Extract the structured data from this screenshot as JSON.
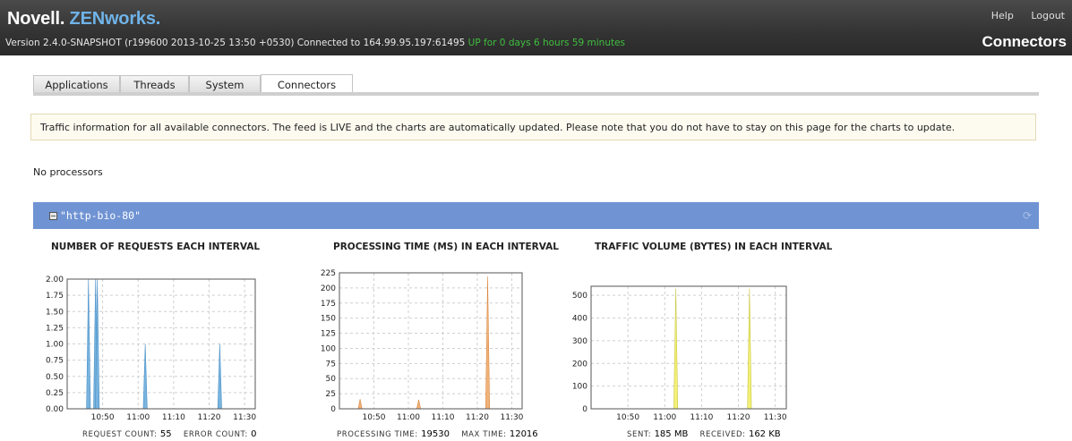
{
  "header": {
    "brand_main": "Novell.",
    "brand_product": "ZENworks.",
    "version_text": "Version 2.4.0-SNAPSHOT (r199600 2013-10-25 13:50 +0530) Connected to 164.99.95.197:61495",
    "uptime_text": "UP for 0 days 6 hours 59 minutes",
    "links": [
      "Help",
      "Logout"
    ],
    "page_name": "Connectors"
  },
  "tabs": [
    "Applications",
    "Threads",
    "System",
    "Connectors"
  ],
  "active_tab": "Connectors",
  "notice": "Traffic information for all available connectors. The feed is LIVE and the charts are automatically updated. Please note that you do not have to stay on this page for the charts to update.",
  "no_processors": "No processors",
  "connector": {
    "toggle": "−",
    "name": "\"http-bio-80\""
  },
  "colors": {
    "header_bg": "#333333",
    "brand_accent": "#6fb3e8",
    "uptime": "#3fbf3f",
    "connector_bar": "#6f93d3",
    "requests_series": "#79b4de",
    "processing_series": "#f0b27a",
    "traffic_series": "#f3f078"
  },
  "chart_data": [
    {
      "type": "area",
      "title": "NUMBER OF REQUESTS EACH INTERVAL",
      "x_ticks": [
        "10:50",
        "11:00",
        "11:10",
        "11:20",
        "11:30"
      ],
      "y_ticks": [
        "0.00",
        "0.25",
        "0.50",
        "0.75",
        "1.00",
        "1.25",
        "1.50",
        "1.75",
        "2.00"
      ],
      "ylim": [
        0,
        2
      ],
      "grid": true,
      "spikes": [
        {
          "t": "10:46",
          "value": 2.0
        },
        {
          "t": "10:48",
          "value": 2.0
        },
        {
          "t": "10:48.5",
          "value": 2.0
        },
        {
          "t": "11:02",
          "value": 1.0
        },
        {
          "t": "11:23",
          "value": 1.0
        }
      ],
      "footer": [
        {
          "label": "REQUEST COUNT:",
          "value": "55"
        },
        {
          "label": "ERROR COUNT:",
          "value": "0"
        }
      ]
    },
    {
      "type": "area",
      "title": "PROCESSING TIME (MS) IN EACH INTERVAL",
      "x_ticks": [
        "10:50",
        "11:00",
        "11:10",
        "11:20",
        "11:30"
      ],
      "y_ticks": [
        "0",
        "25",
        "50",
        "75",
        "100",
        "125",
        "150",
        "175",
        "200",
        "225"
      ],
      "ylim": [
        0,
        225
      ],
      "grid": true,
      "spikes": [
        {
          "t": "10:46",
          "value": 16
        },
        {
          "t": "11:03",
          "value": 15
        },
        {
          "t": "11:23",
          "value": 219
        }
      ],
      "footer": [
        {
          "label": "PROCESSING TIME:",
          "value": "19530"
        },
        {
          "label": "MAX TIME:",
          "value": "12016"
        }
      ]
    },
    {
      "type": "area",
      "title": "TRAFFIC VOLUME (BYTES) IN EACH INTERVAL",
      "x_ticks": [
        "10:50",
        "11:00",
        "11:10",
        "11:20",
        "11:30"
      ],
      "y_ticks": [
        "0",
        "100",
        "200",
        "300",
        "400",
        "500"
      ],
      "ylim": [
        0,
        540
      ],
      "grid": true,
      "spikes": [
        {
          "t": "11:03",
          "value": 530
        },
        {
          "t": "11:23",
          "value": 530
        }
      ],
      "footer": [
        {
          "label": "SENT:",
          "value": "185 MB"
        },
        {
          "label": "RECEIVED:",
          "value": "162 KB"
        }
      ]
    }
  ]
}
